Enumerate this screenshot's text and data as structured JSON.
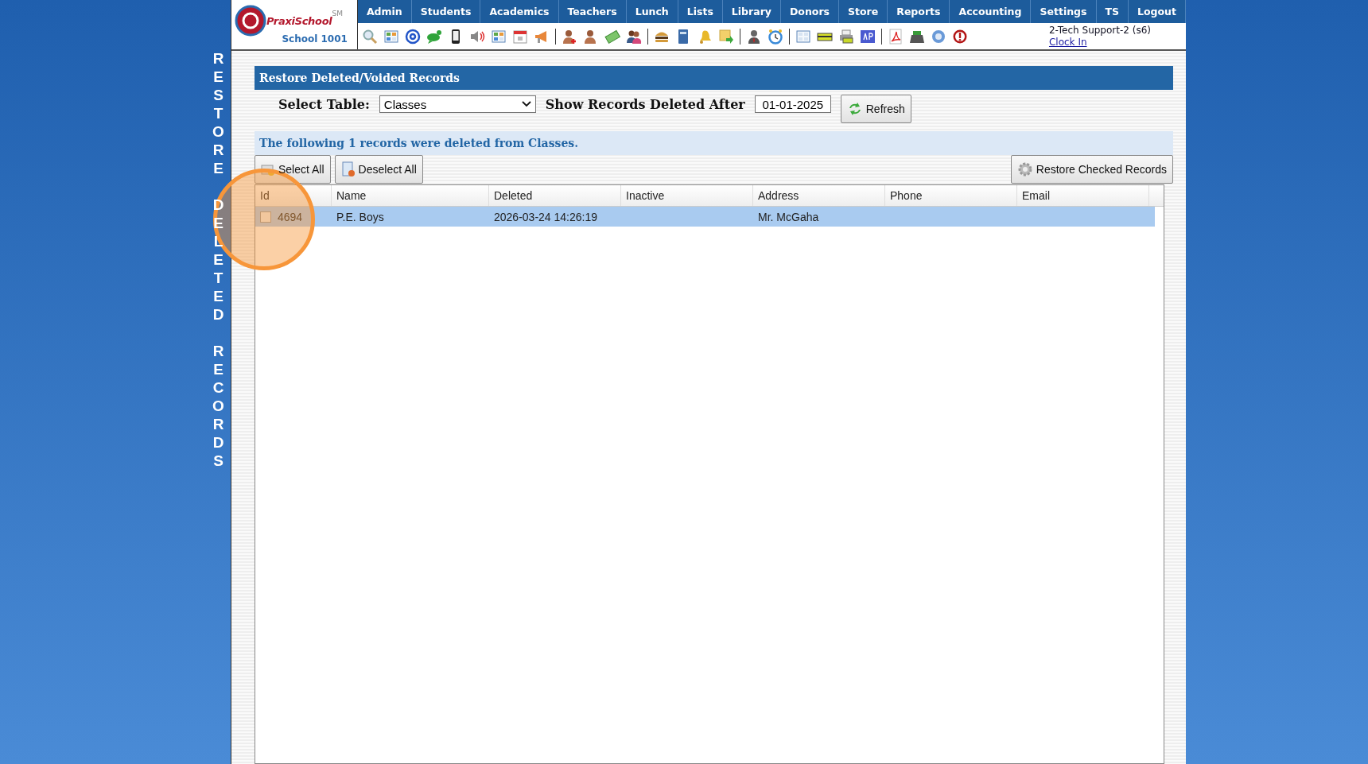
{
  "logo": {
    "brand": "PraxiSchool",
    "tm": "SM",
    "school": "School 1001"
  },
  "menu": [
    {
      "label": "Admin"
    },
    {
      "label": "Students"
    },
    {
      "label": "Academics"
    },
    {
      "label": "Teachers"
    },
    {
      "label": "Lunch"
    },
    {
      "label": "Lists"
    },
    {
      "label": "Library"
    },
    {
      "label": "Donors"
    },
    {
      "label": "Store"
    },
    {
      "label": "Reports"
    },
    {
      "label": "Accounting"
    },
    {
      "label": "Settings"
    },
    {
      "label": "TS"
    },
    {
      "label": "Logout"
    }
  ],
  "user": {
    "name": "2-Tech Support-2 (s6)",
    "link": "Clock In"
  },
  "side_title": "RESTORE DELETED RECORDS",
  "panel": {
    "title": "Restore Deleted/Voided Records",
    "select_label": "Select Table:",
    "select_value": "Classes",
    "date_label": "Show Records Deleted After",
    "date_value": "01-01-2025",
    "refresh": "Refresh",
    "message": "The following 1 records were deleted from Classes.",
    "select_all": "Select All",
    "deselect_all": "Deselect All",
    "restore": "Restore Checked Records"
  },
  "table": {
    "columns": [
      "Id",
      "Name",
      "Deleted",
      "Inactive",
      "Address",
      "Phone",
      "Email"
    ],
    "rows": [
      {
        "selected": true,
        "checked": false,
        "id": "4694",
        "name": "P.E. Boys",
        "deleted": "2026-03-24 14:26:19",
        "address": "Mr. McGaha"
      }
    ]
  }
}
